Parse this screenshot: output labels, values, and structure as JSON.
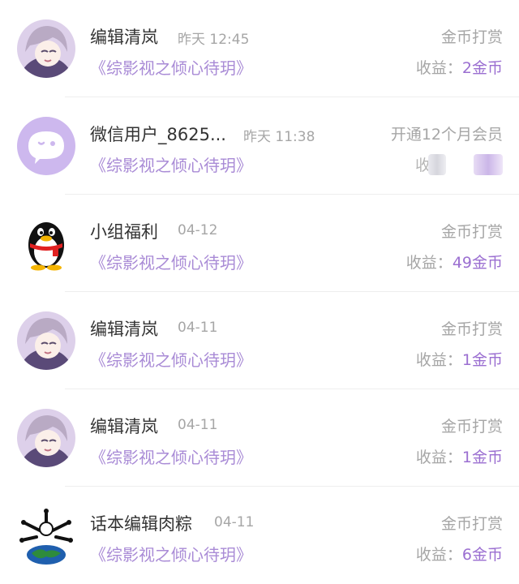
{
  "rows": [
    {
      "name": "编辑清岚",
      "time": "昨天 12:45",
      "type": "金币打赏",
      "book": "《综影视之倾心待玥》",
      "earn_label": "收益：",
      "earn_value": "2金币"
    },
    {
      "name": "微信用户_8625...",
      "time": "昨天 11:38",
      "type": "开通12个月会员",
      "book": "《综影视之倾心待玥》",
      "earn_label": "收",
      "earn_value": ""
    },
    {
      "name": "小组福利",
      "time": "04-12",
      "type": "金币打赏",
      "book": "《综影视之倾心待玥》",
      "earn_label": "收益：",
      "earn_value": "49金币"
    },
    {
      "name": "编辑清岚",
      "time": "04-11",
      "type": "金币打赏",
      "book": "《综影视之倾心待玥》",
      "earn_label": "收益：",
      "earn_value": "1金币"
    },
    {
      "name": "编辑清岚",
      "time": "04-11",
      "type": "金币打赏",
      "book": "《综影视之倾心待玥》",
      "earn_label": "收益：",
      "earn_value": "1金币"
    },
    {
      "name": "话本编辑肉粽",
      "time": "04-11",
      "type": "金币打赏",
      "book": "《综影视之倾心待玥》",
      "earn_label": "收益：",
      "earn_value": "6金币"
    }
  ],
  "colors": {
    "accent": "#9b6fd1",
    "book": "#a98bd6",
    "muted": "#a6a6a6"
  }
}
